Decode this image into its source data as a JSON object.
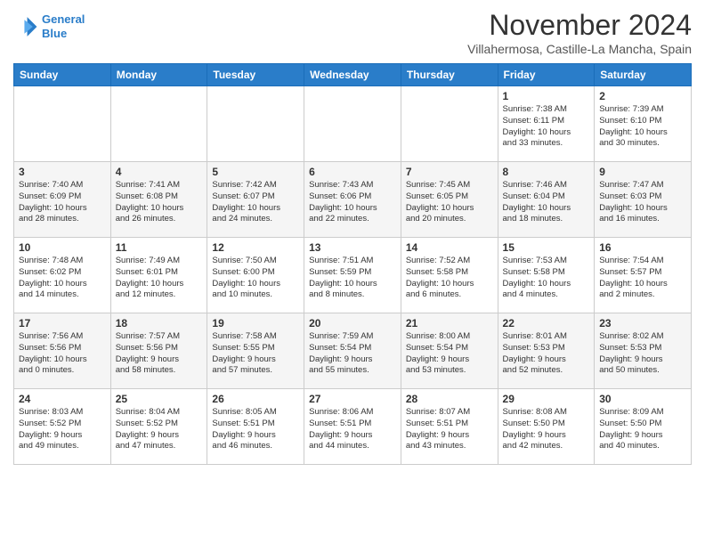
{
  "logo": {
    "line1": "General",
    "line2": "Blue"
  },
  "header": {
    "month": "November 2024",
    "location": "Villahermosa, Castille-La Mancha, Spain"
  },
  "weekdays": [
    "Sunday",
    "Monday",
    "Tuesday",
    "Wednesday",
    "Thursday",
    "Friday",
    "Saturday"
  ],
  "weeks": [
    [
      {
        "day": "",
        "info": ""
      },
      {
        "day": "",
        "info": ""
      },
      {
        "day": "",
        "info": ""
      },
      {
        "day": "",
        "info": ""
      },
      {
        "day": "",
        "info": ""
      },
      {
        "day": "1",
        "info": "Sunrise: 7:38 AM\nSunset: 6:11 PM\nDaylight: 10 hours\nand 33 minutes."
      },
      {
        "day": "2",
        "info": "Sunrise: 7:39 AM\nSunset: 6:10 PM\nDaylight: 10 hours\nand 30 minutes."
      }
    ],
    [
      {
        "day": "3",
        "info": "Sunrise: 7:40 AM\nSunset: 6:09 PM\nDaylight: 10 hours\nand 28 minutes."
      },
      {
        "day": "4",
        "info": "Sunrise: 7:41 AM\nSunset: 6:08 PM\nDaylight: 10 hours\nand 26 minutes."
      },
      {
        "day": "5",
        "info": "Sunrise: 7:42 AM\nSunset: 6:07 PM\nDaylight: 10 hours\nand 24 minutes."
      },
      {
        "day": "6",
        "info": "Sunrise: 7:43 AM\nSunset: 6:06 PM\nDaylight: 10 hours\nand 22 minutes."
      },
      {
        "day": "7",
        "info": "Sunrise: 7:45 AM\nSunset: 6:05 PM\nDaylight: 10 hours\nand 20 minutes."
      },
      {
        "day": "8",
        "info": "Sunrise: 7:46 AM\nSunset: 6:04 PM\nDaylight: 10 hours\nand 18 minutes."
      },
      {
        "day": "9",
        "info": "Sunrise: 7:47 AM\nSunset: 6:03 PM\nDaylight: 10 hours\nand 16 minutes."
      }
    ],
    [
      {
        "day": "10",
        "info": "Sunrise: 7:48 AM\nSunset: 6:02 PM\nDaylight: 10 hours\nand 14 minutes."
      },
      {
        "day": "11",
        "info": "Sunrise: 7:49 AM\nSunset: 6:01 PM\nDaylight: 10 hours\nand 12 minutes."
      },
      {
        "day": "12",
        "info": "Sunrise: 7:50 AM\nSunset: 6:00 PM\nDaylight: 10 hours\nand 10 minutes."
      },
      {
        "day": "13",
        "info": "Sunrise: 7:51 AM\nSunset: 5:59 PM\nDaylight: 10 hours\nand 8 minutes."
      },
      {
        "day": "14",
        "info": "Sunrise: 7:52 AM\nSunset: 5:58 PM\nDaylight: 10 hours\nand 6 minutes."
      },
      {
        "day": "15",
        "info": "Sunrise: 7:53 AM\nSunset: 5:58 PM\nDaylight: 10 hours\nand 4 minutes."
      },
      {
        "day": "16",
        "info": "Sunrise: 7:54 AM\nSunset: 5:57 PM\nDaylight: 10 hours\nand 2 minutes."
      }
    ],
    [
      {
        "day": "17",
        "info": "Sunrise: 7:56 AM\nSunset: 5:56 PM\nDaylight: 10 hours\nand 0 minutes."
      },
      {
        "day": "18",
        "info": "Sunrise: 7:57 AM\nSunset: 5:56 PM\nDaylight: 9 hours\nand 58 minutes."
      },
      {
        "day": "19",
        "info": "Sunrise: 7:58 AM\nSunset: 5:55 PM\nDaylight: 9 hours\nand 57 minutes."
      },
      {
        "day": "20",
        "info": "Sunrise: 7:59 AM\nSunset: 5:54 PM\nDaylight: 9 hours\nand 55 minutes."
      },
      {
        "day": "21",
        "info": "Sunrise: 8:00 AM\nSunset: 5:54 PM\nDaylight: 9 hours\nand 53 minutes."
      },
      {
        "day": "22",
        "info": "Sunrise: 8:01 AM\nSunset: 5:53 PM\nDaylight: 9 hours\nand 52 minutes."
      },
      {
        "day": "23",
        "info": "Sunrise: 8:02 AM\nSunset: 5:53 PM\nDaylight: 9 hours\nand 50 minutes."
      }
    ],
    [
      {
        "day": "24",
        "info": "Sunrise: 8:03 AM\nSunset: 5:52 PM\nDaylight: 9 hours\nand 49 minutes."
      },
      {
        "day": "25",
        "info": "Sunrise: 8:04 AM\nSunset: 5:52 PM\nDaylight: 9 hours\nand 47 minutes."
      },
      {
        "day": "26",
        "info": "Sunrise: 8:05 AM\nSunset: 5:51 PM\nDaylight: 9 hours\nand 46 minutes."
      },
      {
        "day": "27",
        "info": "Sunrise: 8:06 AM\nSunset: 5:51 PM\nDaylight: 9 hours\nand 44 minutes."
      },
      {
        "day": "28",
        "info": "Sunrise: 8:07 AM\nSunset: 5:51 PM\nDaylight: 9 hours\nand 43 minutes."
      },
      {
        "day": "29",
        "info": "Sunrise: 8:08 AM\nSunset: 5:50 PM\nDaylight: 9 hours\nand 42 minutes."
      },
      {
        "day": "30",
        "info": "Sunrise: 8:09 AM\nSunset: 5:50 PM\nDaylight: 9 hours\nand 40 minutes."
      }
    ]
  ]
}
